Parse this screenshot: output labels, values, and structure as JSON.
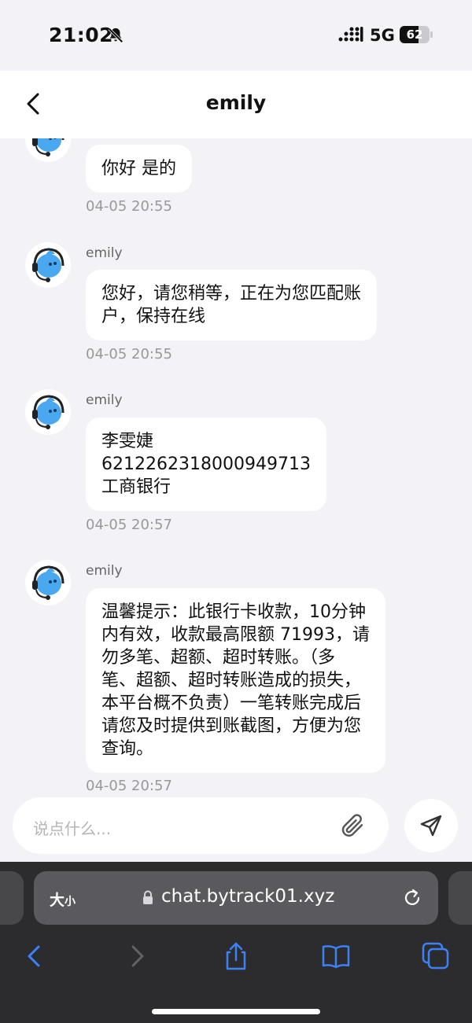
{
  "status_bar": {
    "time": "21:02",
    "network": "5G",
    "battery_percent": "62",
    "battery_level": 0.62
  },
  "header": {
    "title": "emily"
  },
  "messages": [
    {
      "sender": "",
      "text": "你好 是的",
      "time": "04-05 20:55"
    },
    {
      "sender": "emily",
      "text": "您好，请您稍等，正在为您匹配账\n户，保持在线",
      "time": "04-05 20:55"
    },
    {
      "sender": "emily",
      "text": "李雯婕\n6212262318000949713\n工商银行",
      "time": "04-05 20:57"
    },
    {
      "sender": "emily",
      "text": "温馨提示：此银行卡收款，10分钟\n内有效，收款最高限额 71993，请\n勿多笔、超额、超时转账。（多\n笔、超额、超时转账造成的损失，\n本平台概不负责）一笔转账完成后\n请您及时提供到账截图，方便为您\n查询。",
      "time": "04-05 20:57"
    }
  ],
  "composer": {
    "placeholder": "说点什么..."
  },
  "browser": {
    "text_size_big": "大",
    "text_size_small": "小",
    "url": "chat.bytrack01.xyz"
  },
  "icons": {
    "back": "chevron-left-icon",
    "attach": "paperclip-icon",
    "send": "send-icon",
    "mute": "bell-slash-icon",
    "lock": "lock-icon",
    "reload": "reload-icon",
    "share": "share-icon",
    "bookmarks": "book-icon",
    "tabs": "tabs-icon"
  },
  "colors": {
    "safari_blue": "#3b82f6",
    "avatar_blue": "#4aa8f0"
  }
}
